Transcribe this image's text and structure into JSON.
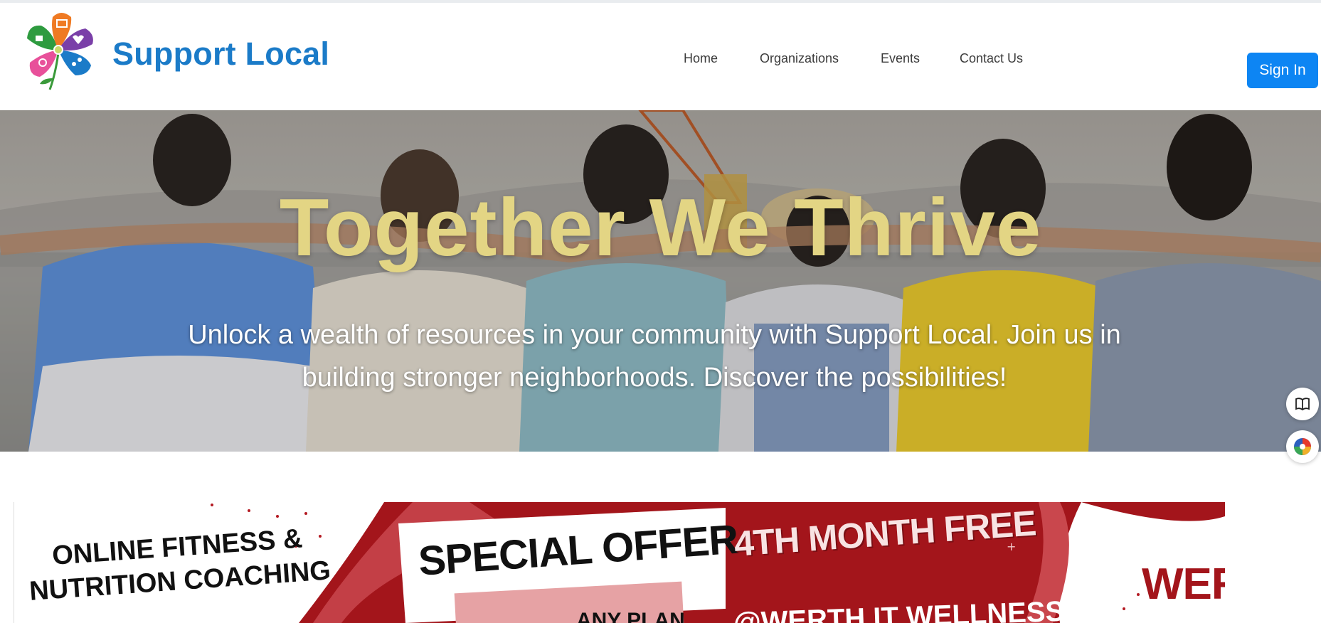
{
  "brand": {
    "name": "Support Local"
  },
  "nav": {
    "items": [
      {
        "label": "Home"
      },
      {
        "label": "Organizations"
      },
      {
        "label": "Events"
      },
      {
        "label": "Contact Us"
      }
    ],
    "sign_in_label": "Sign In"
  },
  "hero": {
    "title": "Together We Thrive",
    "subtitle": "Unlock a wealth of resources in your community with Support Local. Join us in building stronger neighborhoods. Discover the possibilities!"
  },
  "side_buttons": {
    "icons": [
      "book-icon",
      "color-wheel-icon"
    ]
  },
  "banner": {
    "left_text_line1": "ONLINE FITNESS &",
    "left_text_line2": "NUTRITION COACHING",
    "offer": "SPECIAL OFFER",
    "free": "4TH MONTH FREE",
    "brand": "WERTH",
    "handle": "@WERTH IT WELLNESS",
    "plan": "ANY PLAN"
  },
  "colors": {
    "brand_blue": "#1b7bc8",
    "button_blue": "#0d85f3",
    "hero_title": "#e3d584",
    "banner_red": "#a3151b"
  }
}
